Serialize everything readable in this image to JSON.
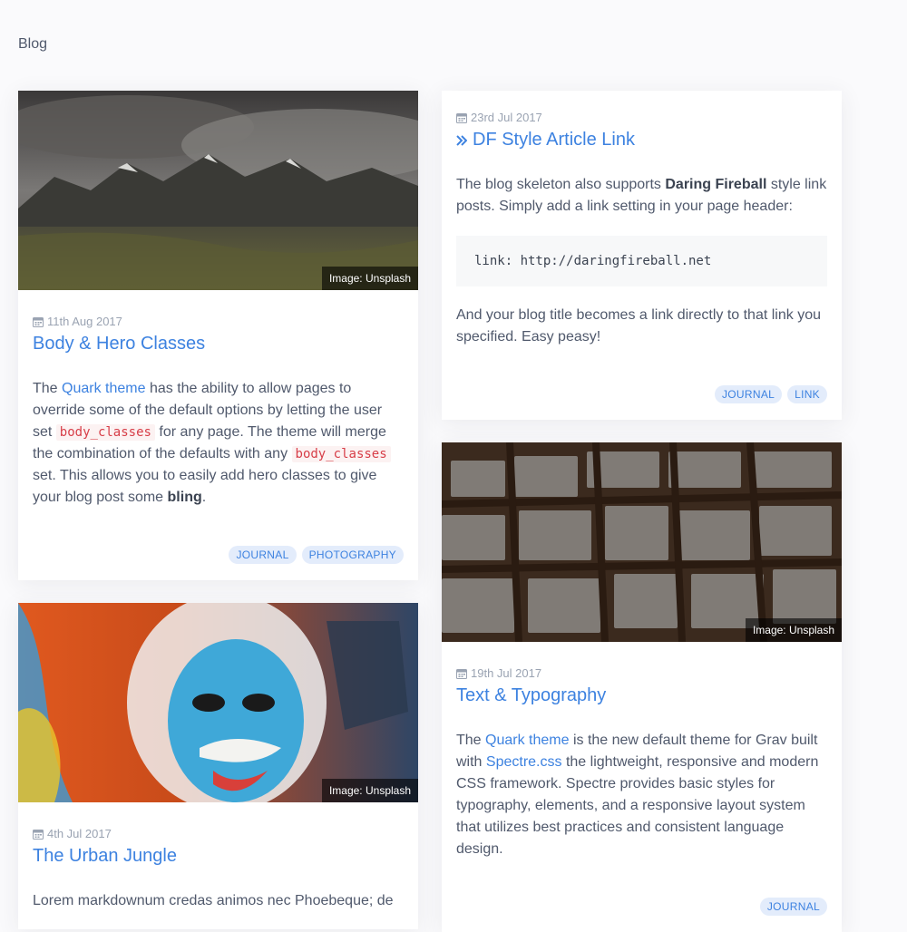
{
  "breadcrumb": "Blog",
  "cards": [
    {
      "date": "11th Aug 2017",
      "title": "Body & Hero Classes",
      "image_credit": "Image: Unsplash",
      "body": {
        "p1": "The ",
        "link1": "Quark theme",
        "p2": " has the ability to allow pages to override some of the default options by letting the user set ",
        "code1": "body_classes",
        "p3": " for any page. The theme will merge the combination of the defaults with any ",
        "code2": "body_classes",
        "p4": " set. This allows you to easily add hero classes to give your blog post some ",
        "bold1": "bling",
        "p5": "."
      },
      "tags": [
        "JOURNAL",
        "PHOTOGRAPHY"
      ]
    },
    {
      "date": "23rd Jul 2017",
      "title": "DF Style Article Link",
      "body": {
        "p1": "The blog skeleton also supports ",
        "bold1": "Daring Fireball",
        "p2": " style link posts. Simply add a link setting in your page header:",
        "code": "link: http://daringfireball.net",
        "p3": "And your blog title becomes a link directly to that link you specified. Easy peasy!"
      },
      "tags": [
        "JOURNAL",
        "LINK"
      ]
    },
    {
      "date": "19th Jul 2017",
      "title": "Text & Typography",
      "image_credit": "Image: Unsplash",
      "body": {
        "p1": "The ",
        "link1": "Quark theme",
        "p2": " is the new default theme for Grav built with ",
        "link2": "Spectre.css",
        "p3": " the lightweight, responsive and modern CSS framework. Spectre provides basic styles for typography, elements, and a responsive layout system that utilizes best practices and consistent language design."
      },
      "tags": [
        "JOURNAL"
      ]
    },
    {
      "date": "4th Jul 2017",
      "title": "The Urban Jungle",
      "image_credit": "Image: Unsplash",
      "body": {
        "p1": "Lorem markdownum credas animos nec Phoebeque; de"
      }
    }
  ],
  "colors": {
    "accent": "#3d82e0",
    "text": "#50596c",
    "muted": "#9aa3b2",
    "tag_bg": "#e3ecfb"
  },
  "icons": {
    "date": "calendar-icon",
    "link_title": "double-chevron-right-icon"
  }
}
